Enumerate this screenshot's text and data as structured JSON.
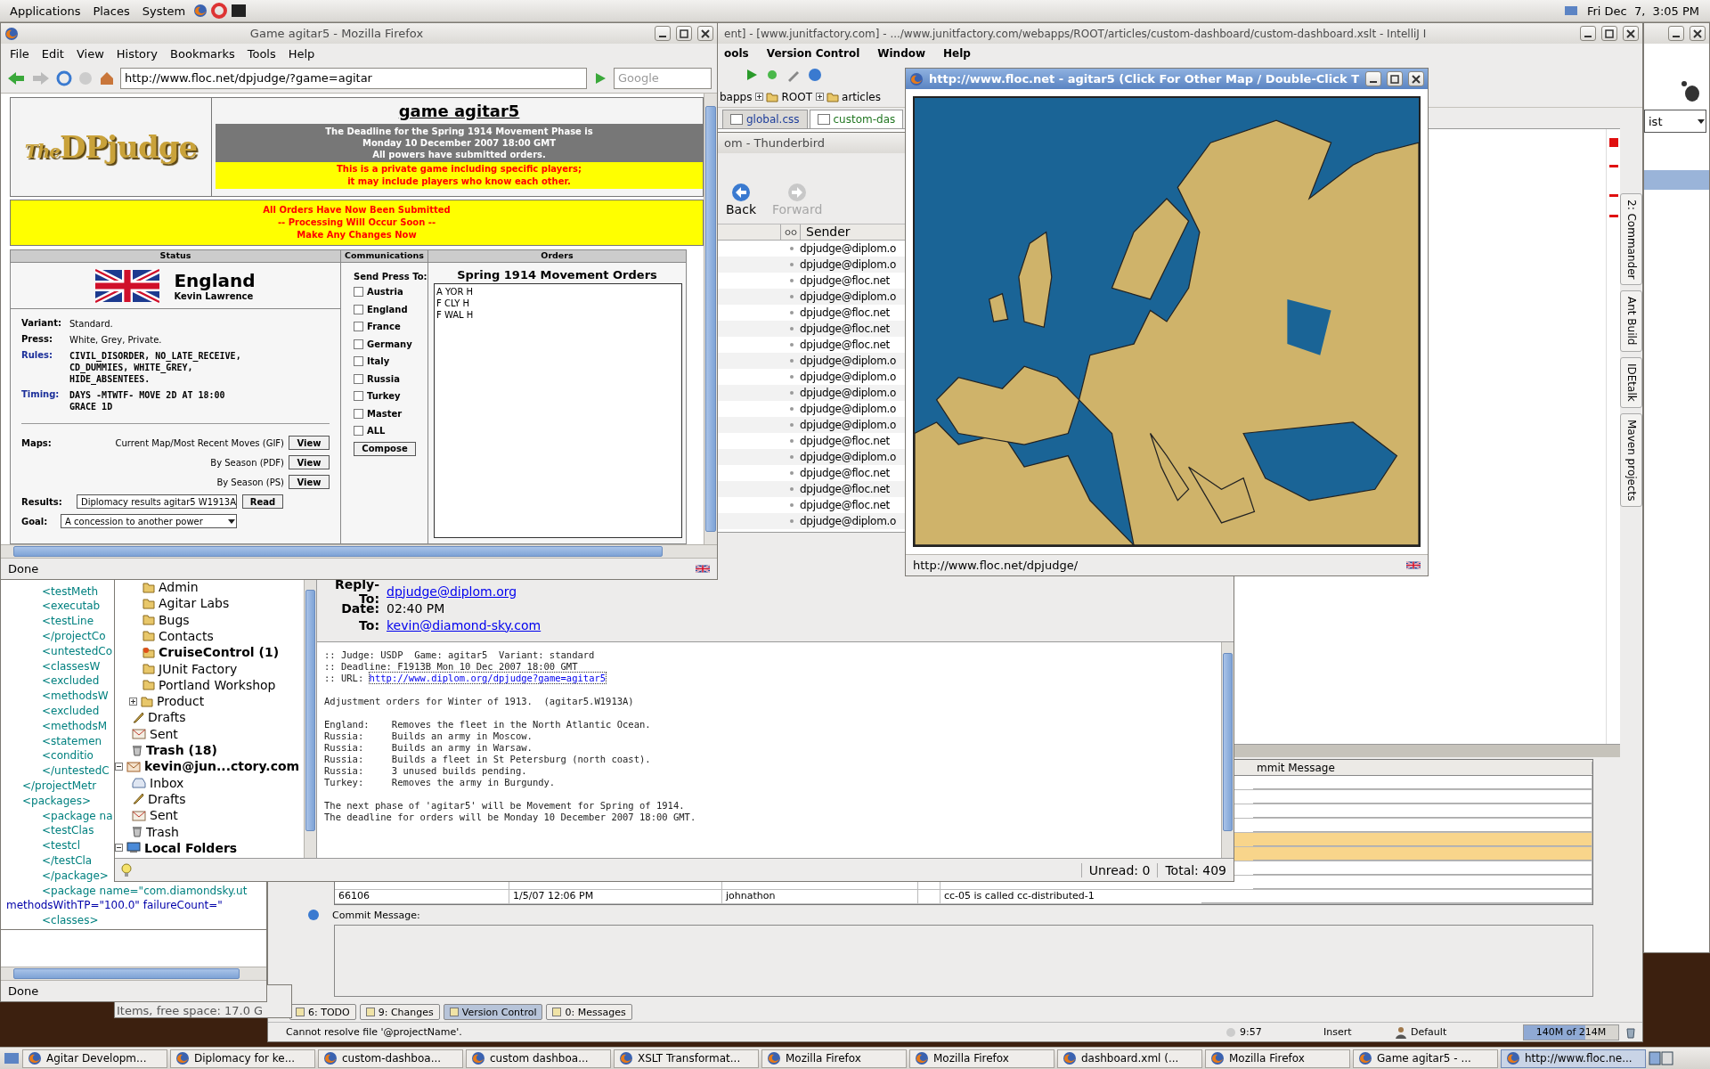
{
  "top_panel": {
    "menus": [
      "Applications",
      "Places",
      "System"
    ],
    "clock": "Fri Dec  7,  3:05 PM"
  },
  "intellij": {
    "title": "ent] - [www.junitfactory.com] - .../www.junitfactory.com/webapps/ROOT/articles/custom-dashboard/custom-dashboard.xslt - IntelliJ I",
    "menus": [
      "ools",
      "Version Control",
      "Window",
      "Help"
    ],
    "breadcrumbs": [
      "bapps",
      "ROOT",
      "articles"
    ],
    "tabs": [
      {
        "label": "global.css",
        "selected": false
      },
      {
        "label": "custom-das",
        "selected": true
      }
    ],
    "side_tabs": [
      "2: Commander",
      "Ant Build",
      "IDEtalk",
      "Maven projects"
    ],
    "vcs_header": "mmit Message",
    "vcs_rows": [
      {
        "highlighted": false
      },
      {
        "highlighted": false
      },
      {
        "highlighted": false
      },
      {
        "highlighted": false
      },
      {
        "highlighted": true
      },
      {
        "highlighted": true
      },
      {
        "highlighted": false
      },
      {
        "highlighted": false
      },
      {
        "highlighted": false,
        "revision": "66106",
        "date": "1/5/07 12:06 PM",
        "author": "johnathon",
        "message": "cc-05 is called cc-distributed-1"
      }
    ],
    "commit_label": "Commit Message:",
    "tool_tabs": [
      {
        "label": "6: TODO",
        "selected": false
      },
      {
        "label": "9: Changes",
        "selected": false
      },
      {
        "label": "Version Control",
        "selected": true
      },
      {
        "label": "0: Messages",
        "selected": false
      }
    ],
    "status": {
      "message": "Cannot resolve file '@projectName'.",
      "position": "9:57",
      "mode": "Insert",
      "scheme": "Default",
      "memory": "140M of 214M",
      "level": 0.65
    }
  },
  "right_window": {
    "dropdown": "ist"
  },
  "xml_editor": {
    "lines": [
      {
        "text": "<testMeth",
        "kind": "tag"
      },
      {
        "text": "<executab",
        "kind": "tag"
      },
      {
        "text": "<testLine",
        "kind": "tag"
      },
      {
        "text": "</projectCo",
        "kind": "tag"
      },
      {
        "text": "<untestedCo",
        "kind": "tag"
      },
      {
        "text": "<classesW",
        "kind": "tag"
      },
      {
        "text": "<excluded",
        "kind": "tag"
      },
      {
        "text": "<methodsW",
        "kind": "tag"
      },
      {
        "text": "<excluded",
        "kind": "tag"
      },
      {
        "text": "<methodsM",
        "kind": "tag"
      },
      {
        "text": "<statemen",
        "kind": "tag"
      },
      {
        "text": "<conditio",
        "kind": "tag"
      },
      {
        "text": "</untestedC",
        "kind": "tag"
      },
      {
        "text": "</projectMetr",
        "kind": "outer"
      },
      {
        "text": "<packages>",
        "kind": "outer"
      },
      {
        "text": "<package na",
        "kind": "tag"
      },
      {
        "text": "<testClas",
        "kind": "tag"
      },
      {
        "text": "<testcl",
        "kind": "tag"
      },
      {
        "text": "</testCla",
        "kind": "tag"
      },
      {
        "text": "</package>",
        "kind": "tag"
      },
      {
        "text": "<package name=\"com.diamondsky.ut",
        "kind": "tag"
      },
      {
        "text": "methodsWithTP=\"100.0\" failureCount=\"",
        "kind": "attr"
      },
      {
        "text": "<classes>",
        "kind": "tag"
      }
    ]
  },
  "firefox_small": {
    "status": "Done"
  },
  "file_manager": {
    "status": "Items, free space: 17.0 G"
  },
  "thunderbird": {
    "title": "om - Thunderbird",
    "back": "Back",
    "forward": "Forward",
    "sender_column": "Sender",
    "senders": [
      "dpjudge@diplom.o",
      "dpjudge@diplom.o",
      "dpjudge@floc.net",
      "dpjudge@diplom.o",
      "dpjudge@floc.net",
      "dpjudge@floc.net",
      "dpjudge@floc.net",
      "dpjudge@diplom.o",
      "dpjudge@diplom.o",
      "dpjudge@diplom.o",
      "dpjudge@diplom.o",
      "dpjudge@diplom.o",
      "dpjudge@floc.net",
      "dpjudge@diplom.o",
      "dpjudge@floc.net",
      "dpjudge@floc.net",
      "dpjudge@floc.net",
      "dpjudge@diplom.o"
    ],
    "folders": [
      {
        "children": [
          {
            "children": [
              {
                "label": "Admin",
                "kind": "folder",
                "unread": false
              },
              {
                "label": "Agitar Labs",
                "kind": "folder",
                "unread": false
              },
              {
                "label": "Bugs",
                "kind": "folder",
                "unread": false
              },
              {
                "label": "Contacts",
                "kind": "folder",
                "unread": false
              },
              {
                "label": "CruiseControl (1)",
                "kind": "feed",
                "unread": true
              },
              {
                "label": "JUnit Factory",
                "kind": "folder",
                "unread": false
              },
              {
                "label": "Portland Workshop",
                "kind": "folder",
                "unread": false
              },
              {
                "label": "Product",
                "kind": "folder",
                "unread": false,
                "expanded": false
              }
            ]
          },
          {
            "label": "Drafts",
            "kind": "drafts",
            "unread": false
          },
          {
            "label": "Sent",
            "kind": "sent",
            "unread": false
          },
          {
            "label": "Trash (18)",
            "kind": "trash",
            "unread": true
          }
        ]
      },
      {
        "label": "kevin@jun...ctory.com",
        "kind": "account",
        "unread": true,
        "expanded": true,
        "children": [
          {
            "label": "Inbox",
            "kind": "inbox",
            "unread": false
          },
          {
            "label": "Drafts",
            "kind": "drafts",
            "unread": false
          },
          {
            "label": "Sent",
            "kind": "sent",
            "unread": false
          },
          {
            "label": "Trash",
            "kind": "trash",
            "unread": false
          }
        ]
      },
      {
        "label": "Local Folders",
        "kind": "local",
        "unread": true,
        "expanded": true
      }
    ],
    "headers": [
      {
        "label": "Reply-To:",
        "value": "dpjudge@diplom.org",
        "kind": "link"
      },
      {
        "label": "Date:",
        "value": "02:40 PM",
        "kind": "text"
      },
      {
        "label": "To:",
        "value": "kevin@diamond-sky.com",
        "kind": "link"
      }
    ],
    "body": {
      "intro": [
        ":: Judge: USDP  Game: agitar5  Variant: standard",
        ":: Deadline: F1913B Mon 10 Dec 2007 18:00 GMT"
      ],
      "url_label": ":: URL:",
      "url": "http://www.diplom.org/dpjudge?game=agitar5",
      "paragraphs": [
        [
          "Adjustment orders for Winter of 1913.  (agitar5.W1913A)"
        ],
        [
          "England:    Removes the fleet in the North Atlantic Ocean.",
          "Russia:     Builds an army in Moscow.",
          "Russia:     Builds an army in Warsaw.",
          "Russia:     Builds a fleet in St Petersburg (north coast).",
          "Russia:     3 unused builds pending.",
          "Turkey:     Removes the army in Burgundy."
        ],
        [
          "The next phase of 'agitar5' will be Movement for Spring of 1914.",
          "The deadline for orders will be Monday 10 December 2007 18:00 GMT."
        ]
      ]
    },
    "unread": "Unread: 0",
    "total": "Total: 409"
  },
  "firefox": {
    "title": "Game agitar5 - Mozilla Firefox",
    "menus": [
      "File",
      "Edit",
      "View",
      "History",
      "Bookmarks",
      "Tools",
      "Help"
    ],
    "url": "http://www.floc.net/dpjudge/?game=agitar",
    "search_placeholder": "Google",
    "status": "Done",
    "page": {
      "logo_prefix": "The",
      "logo": "DPjudge",
      "game_title": "game agitar5",
      "deadline_lines": [
        "The Deadline for the Spring 1914 Movement Phase is",
        "Monday 10 December 2007 18:00 GMT",
        "All powers have submitted orders."
      ],
      "private_lines": [
        "This is a private game including specific players;",
        "it may include players who know each other."
      ],
      "banner_lines": [
        "All Orders Have Now Been Submitted",
        "-- Processing Will Occur Soon --",
        "Make Any Changes Now"
      ],
      "section_headers": [
        "Status",
        "Communications",
        "Orders"
      ],
      "power": "England",
      "player": "Kevin Lawrence",
      "info": [
        {
          "label": "Variant:",
          "kind": "plain",
          "lines": [
            "Standard."
          ]
        },
        {
          "label": "Press:",
          "kind": "plain",
          "lines": [
            "White, Grey, Private."
          ]
        },
        {
          "label": "Rules:",
          "kind": "rule",
          "lines": [
            "CIVIL_DISORDER, NO_LATE_RECEIVE,",
            "CD_DUMMIES, WHITE_GREY,",
            "HIDE_ABSENTEES."
          ]
        },
        {
          "label": "Timing:",
          "kind": "rule",
          "lines": [
            "DAYS -MTWTF- MOVE 2D AT 18:00",
            "GRACE 1D"
          ]
        }
      ],
      "maps_label": "Maps:",
      "maps": [
        {
          "label": "Current Map/Most Recent Moves (GIF)",
          "button": "View"
        },
        {
          "label": "By Season (PDF)",
          "button": "View"
        },
        {
          "label": "By Season (PS)",
          "button": "View"
        }
      ],
      "results_label": "Results:",
      "results_value": "Diplomacy results agitar5 W1913A",
      "results_button": "Read",
      "goal_label": "Goal:",
      "goal_value": "A concession to another power",
      "press_label": "Send Press To:",
      "press_targets": [
        {
          "label": "Austria",
          "checked": false
        },
        {
          "label": "England",
          "checked": false
        },
        {
          "label": "France",
          "checked": false
        },
        {
          "label": "Germany",
          "checked": false
        },
        {
          "label": "Italy",
          "checked": false
        },
        {
          "label": "Russia",
          "checked": false
        },
        {
          "label": "Turkey",
          "checked": false
        },
        {
          "label": "Master",
          "checked": false
        },
        {
          "label": "ALL",
          "checked": false
        }
      ],
      "compose": "Compose",
      "orders_title": "Spring 1914 Movement Orders",
      "orders": [
        "A YOR H",
        "F CLY H",
        "F WAL H"
      ]
    }
  },
  "map_window": {
    "title": "http://www.floc.net - agitar5 (Click For Other Map / Double-Click T",
    "status": "http://www.floc.net/dpjudge/"
  },
  "taskbar": [
    {
      "label": "Agitar Developm...",
      "selected": false
    },
    {
      "label": "Diplomacy for ke...",
      "selected": false
    },
    {
      "label": "custom-dashboa...",
      "selected": false
    },
    {
      "label": "custom dashboa...",
      "selected": false
    },
    {
      "label": "XSLT Transformat...",
      "selected": false
    },
    {
      "label": "Mozilla Firefox",
      "selected": false
    },
    {
      "label": "Mozilla Firefox",
      "selected": false
    },
    {
      "label": "dashboard.xml (...",
      "selected": false
    },
    {
      "label": "Mozilla Firefox",
      "selected": false
    },
    {
      "label": "Game agitar5 - ...",
      "selected": false
    },
    {
      "label": "http://www.floc.ne...",
      "selected": true
    }
  ]
}
